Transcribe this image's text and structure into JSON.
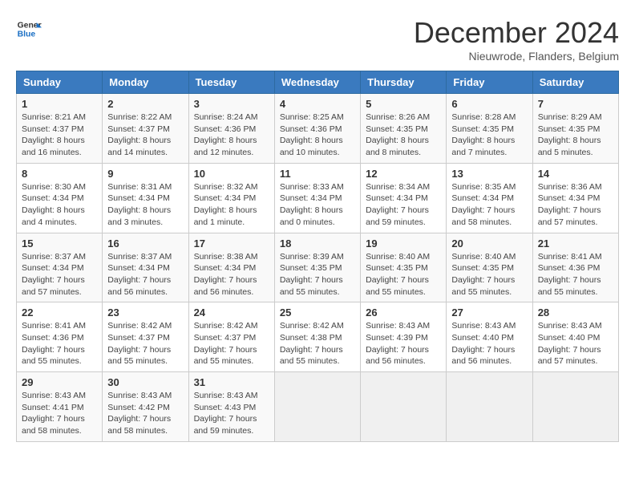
{
  "header": {
    "logo_line1": "General",
    "logo_line2": "Blue",
    "title": "December 2024",
    "subtitle": "Nieuwrode, Flanders, Belgium"
  },
  "calendar": {
    "days_of_week": [
      "Sunday",
      "Monday",
      "Tuesday",
      "Wednesday",
      "Thursday",
      "Friday",
      "Saturday"
    ],
    "weeks": [
      [
        {
          "day": "1",
          "info": "Sunrise: 8:21 AM\nSunset: 4:37 PM\nDaylight: 8 hours\nand 16 minutes."
        },
        {
          "day": "2",
          "info": "Sunrise: 8:22 AM\nSunset: 4:37 PM\nDaylight: 8 hours\nand 14 minutes."
        },
        {
          "day": "3",
          "info": "Sunrise: 8:24 AM\nSunset: 4:36 PM\nDaylight: 8 hours\nand 12 minutes."
        },
        {
          "day": "4",
          "info": "Sunrise: 8:25 AM\nSunset: 4:36 PM\nDaylight: 8 hours\nand 10 minutes."
        },
        {
          "day": "5",
          "info": "Sunrise: 8:26 AM\nSunset: 4:35 PM\nDaylight: 8 hours\nand 8 minutes."
        },
        {
          "day": "6",
          "info": "Sunrise: 8:28 AM\nSunset: 4:35 PM\nDaylight: 8 hours\nand 7 minutes."
        },
        {
          "day": "7",
          "info": "Sunrise: 8:29 AM\nSunset: 4:35 PM\nDaylight: 8 hours\nand 5 minutes."
        }
      ],
      [
        {
          "day": "8",
          "info": "Sunrise: 8:30 AM\nSunset: 4:34 PM\nDaylight: 8 hours\nand 4 minutes."
        },
        {
          "day": "9",
          "info": "Sunrise: 8:31 AM\nSunset: 4:34 PM\nDaylight: 8 hours\nand 3 minutes."
        },
        {
          "day": "10",
          "info": "Sunrise: 8:32 AM\nSunset: 4:34 PM\nDaylight: 8 hours\nand 1 minute."
        },
        {
          "day": "11",
          "info": "Sunrise: 8:33 AM\nSunset: 4:34 PM\nDaylight: 8 hours\nand 0 minutes."
        },
        {
          "day": "12",
          "info": "Sunrise: 8:34 AM\nSunset: 4:34 PM\nDaylight: 7 hours\nand 59 minutes."
        },
        {
          "day": "13",
          "info": "Sunrise: 8:35 AM\nSunset: 4:34 PM\nDaylight: 7 hours\nand 58 minutes."
        },
        {
          "day": "14",
          "info": "Sunrise: 8:36 AM\nSunset: 4:34 PM\nDaylight: 7 hours\nand 57 minutes."
        }
      ],
      [
        {
          "day": "15",
          "info": "Sunrise: 8:37 AM\nSunset: 4:34 PM\nDaylight: 7 hours\nand 57 minutes."
        },
        {
          "day": "16",
          "info": "Sunrise: 8:37 AM\nSunset: 4:34 PM\nDaylight: 7 hours\nand 56 minutes."
        },
        {
          "day": "17",
          "info": "Sunrise: 8:38 AM\nSunset: 4:34 PM\nDaylight: 7 hours\nand 56 minutes."
        },
        {
          "day": "18",
          "info": "Sunrise: 8:39 AM\nSunset: 4:35 PM\nDaylight: 7 hours\nand 55 minutes."
        },
        {
          "day": "19",
          "info": "Sunrise: 8:40 AM\nSunset: 4:35 PM\nDaylight: 7 hours\nand 55 minutes."
        },
        {
          "day": "20",
          "info": "Sunrise: 8:40 AM\nSunset: 4:35 PM\nDaylight: 7 hours\nand 55 minutes."
        },
        {
          "day": "21",
          "info": "Sunrise: 8:41 AM\nSunset: 4:36 PM\nDaylight: 7 hours\nand 55 minutes."
        }
      ],
      [
        {
          "day": "22",
          "info": "Sunrise: 8:41 AM\nSunset: 4:36 PM\nDaylight: 7 hours\nand 55 minutes."
        },
        {
          "day": "23",
          "info": "Sunrise: 8:42 AM\nSunset: 4:37 PM\nDaylight: 7 hours\nand 55 minutes."
        },
        {
          "day": "24",
          "info": "Sunrise: 8:42 AM\nSunset: 4:37 PM\nDaylight: 7 hours\nand 55 minutes."
        },
        {
          "day": "25",
          "info": "Sunrise: 8:42 AM\nSunset: 4:38 PM\nDaylight: 7 hours\nand 55 minutes."
        },
        {
          "day": "26",
          "info": "Sunrise: 8:43 AM\nSunset: 4:39 PM\nDaylight: 7 hours\nand 56 minutes."
        },
        {
          "day": "27",
          "info": "Sunrise: 8:43 AM\nSunset: 4:40 PM\nDaylight: 7 hours\nand 56 minutes."
        },
        {
          "day": "28",
          "info": "Sunrise: 8:43 AM\nSunset: 4:40 PM\nDaylight: 7 hours\nand 57 minutes."
        }
      ],
      [
        {
          "day": "29",
          "info": "Sunrise: 8:43 AM\nSunset: 4:41 PM\nDaylight: 7 hours\nand 58 minutes."
        },
        {
          "day": "30",
          "info": "Sunrise: 8:43 AM\nSunset: 4:42 PM\nDaylight: 7 hours\nand 58 minutes."
        },
        {
          "day": "31",
          "info": "Sunrise: 8:43 AM\nSunset: 4:43 PM\nDaylight: 7 hours\nand 59 minutes."
        },
        {
          "day": "",
          "info": ""
        },
        {
          "day": "",
          "info": ""
        },
        {
          "day": "",
          "info": ""
        },
        {
          "day": "",
          "info": ""
        }
      ]
    ]
  }
}
